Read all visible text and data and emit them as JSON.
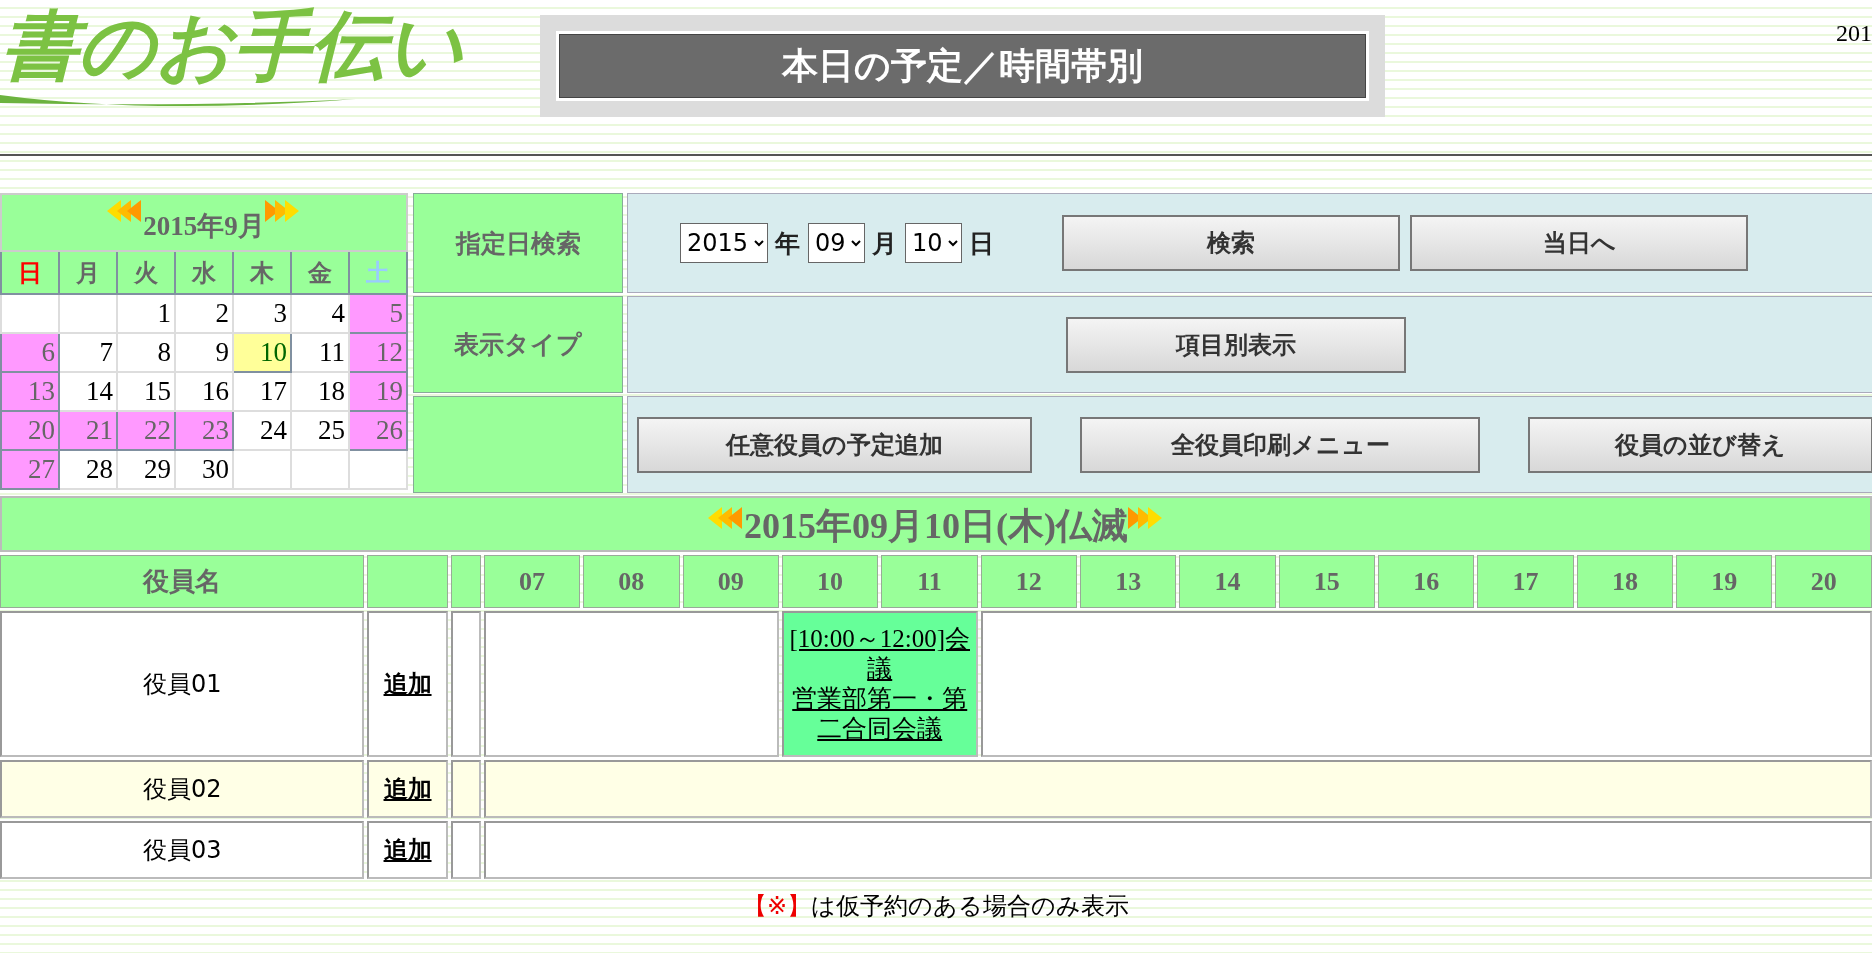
{
  "logo": {
    "text": "書のお手伝い"
  },
  "page_title": "本日の予定／時間帯別",
  "corner_text": "201",
  "calendar": {
    "title": "2015年9月",
    "weekdays": [
      {
        "label": "日",
        "kind": "sunday"
      },
      {
        "label": "月",
        "kind": "weekday"
      },
      {
        "label": "火",
        "kind": "weekday"
      },
      {
        "label": "水",
        "kind": "weekday"
      },
      {
        "label": "木",
        "kind": "weekday"
      },
      {
        "label": "金",
        "kind": "weekday"
      },
      {
        "label": "土",
        "kind": "saturday"
      }
    ],
    "weeks": [
      [
        {
          "kind": "blank"
        },
        {
          "kind": "blank"
        },
        {
          "kind": "day",
          "day": "1",
          "holiday": false,
          "selected": false
        },
        {
          "kind": "day",
          "day": "2",
          "holiday": false,
          "selected": false
        },
        {
          "kind": "day",
          "day": "3",
          "holiday": false,
          "selected": false
        },
        {
          "kind": "day",
          "day": "4",
          "holiday": false,
          "selected": false
        },
        {
          "kind": "day",
          "day": "5",
          "holiday": true,
          "selected": false
        }
      ],
      [
        {
          "kind": "day",
          "day": "6",
          "holiday": true,
          "selected": false
        },
        {
          "kind": "day",
          "day": "7",
          "holiday": false,
          "selected": false
        },
        {
          "kind": "day",
          "day": "8",
          "holiday": false,
          "selected": false
        },
        {
          "kind": "day",
          "day": "9",
          "holiday": false,
          "selected": false
        },
        {
          "kind": "day",
          "day": "10",
          "holiday": false,
          "selected": true
        },
        {
          "kind": "day",
          "day": "11",
          "holiday": false,
          "selected": false
        },
        {
          "kind": "day",
          "day": "12",
          "holiday": true,
          "selected": false
        }
      ],
      [
        {
          "kind": "day",
          "day": "13",
          "holiday": true,
          "selected": false
        },
        {
          "kind": "day",
          "day": "14",
          "holiday": false,
          "selected": false
        },
        {
          "kind": "day",
          "day": "15",
          "holiday": false,
          "selected": false
        },
        {
          "kind": "day",
          "day": "16",
          "holiday": false,
          "selected": false
        },
        {
          "kind": "day",
          "day": "17",
          "holiday": false,
          "selected": false
        },
        {
          "kind": "day",
          "day": "18",
          "holiday": false,
          "selected": false
        },
        {
          "kind": "day",
          "day": "19",
          "holiday": true,
          "selected": false
        }
      ],
      [
        {
          "kind": "day",
          "day": "20",
          "holiday": true,
          "selected": false
        },
        {
          "kind": "day",
          "day": "21",
          "holiday": true,
          "selected": false
        },
        {
          "kind": "day",
          "day": "22",
          "holiday": true,
          "selected": false
        },
        {
          "kind": "day",
          "day": "23",
          "holiday": true,
          "selected": false
        },
        {
          "kind": "day",
          "day": "24",
          "holiday": false,
          "selected": false
        },
        {
          "kind": "day",
          "day": "25",
          "holiday": false,
          "selected": false
        },
        {
          "kind": "day",
          "day": "26",
          "holiday": true,
          "selected": false
        }
      ],
      [
        {
          "kind": "day",
          "day": "27",
          "holiday": true,
          "selected": false
        },
        {
          "kind": "day",
          "day": "28",
          "holiday": false,
          "selected": false
        },
        {
          "kind": "day",
          "day": "29",
          "holiday": false,
          "selected": false
        },
        {
          "kind": "day",
          "day": "30",
          "holiday": false,
          "selected": false
        },
        {
          "kind": "blank"
        },
        {
          "kind": "blank"
        },
        {
          "kind": "blank"
        }
      ]
    ]
  },
  "search": {
    "label": "指定日検索",
    "selects": [
      {
        "value": "2015",
        "unit": "年"
      },
      {
        "value": "09",
        "unit": "月"
      },
      {
        "value": "10",
        "unit": "日"
      }
    ],
    "buttons": [
      "検索",
      "当日へ"
    ]
  },
  "display_type": {
    "label": "表示タイプ",
    "buttons": [
      "項目別表示"
    ]
  },
  "actions": {
    "buttons": [
      "任意役員の予定追加",
      "全役員印刷メニュー",
      "役員の並び替え"
    ]
  },
  "date_bar": {
    "text": "2015年09月10日(木)仏滅"
  },
  "schedule": {
    "name_header": "役員名",
    "hours": [
      "07",
      "08",
      "09",
      "10",
      "11",
      "12",
      "13",
      "14",
      "15",
      "16",
      "17",
      "18",
      "19",
      "20"
    ],
    "rows": [
      {
        "name": "役員01",
        "add_link": "追加",
        "shaded": false,
        "slots": [
          {
            "kind": "free"
          },
          {
            "kind": "free"
          },
          {
            "kind": "free"
          },
          {
            "kind": "event",
            "lines": [
              "[10:00～12:00]会議",
              "営業部第一・第二合同会議"
            ]
          },
          {
            "kind": "busy"
          },
          {
            "kind": "free"
          },
          {
            "kind": "free"
          },
          {
            "kind": "free"
          },
          {
            "kind": "free"
          },
          {
            "kind": "free"
          },
          {
            "kind": "free"
          },
          {
            "kind": "free"
          },
          {
            "kind": "free"
          },
          {
            "kind": "free"
          }
        ]
      },
      {
        "name": "役員02",
        "add_link": "追加",
        "shaded": true,
        "slots": [
          {
            "kind": "free"
          },
          {
            "kind": "free"
          },
          {
            "kind": "free"
          },
          {
            "kind": "free"
          },
          {
            "kind": "free"
          },
          {
            "kind": "free"
          },
          {
            "kind": "free"
          },
          {
            "kind": "free"
          },
          {
            "kind": "free"
          },
          {
            "kind": "free"
          },
          {
            "kind": "free"
          },
          {
            "kind": "free"
          },
          {
            "kind": "free"
          },
          {
            "kind": "free"
          }
        ]
      },
      {
        "name": "役員03",
        "add_link": "追加",
        "shaded": false,
        "slots": [
          {
            "kind": "free"
          },
          {
            "kind": "free"
          },
          {
            "kind": "free"
          },
          {
            "kind": "free"
          },
          {
            "kind": "free"
          },
          {
            "kind": "free"
          },
          {
            "kind": "free"
          },
          {
            "kind": "free"
          },
          {
            "kind": "free"
          },
          {
            "kind": "free"
          },
          {
            "kind": "free"
          },
          {
            "kind": "free"
          },
          {
            "kind": "free"
          },
          {
            "kind": "free"
          }
        ]
      }
    ]
  },
  "footer_note": {
    "mark": "【※】",
    "text": "は仮予約のある場合のみ表示"
  }
}
